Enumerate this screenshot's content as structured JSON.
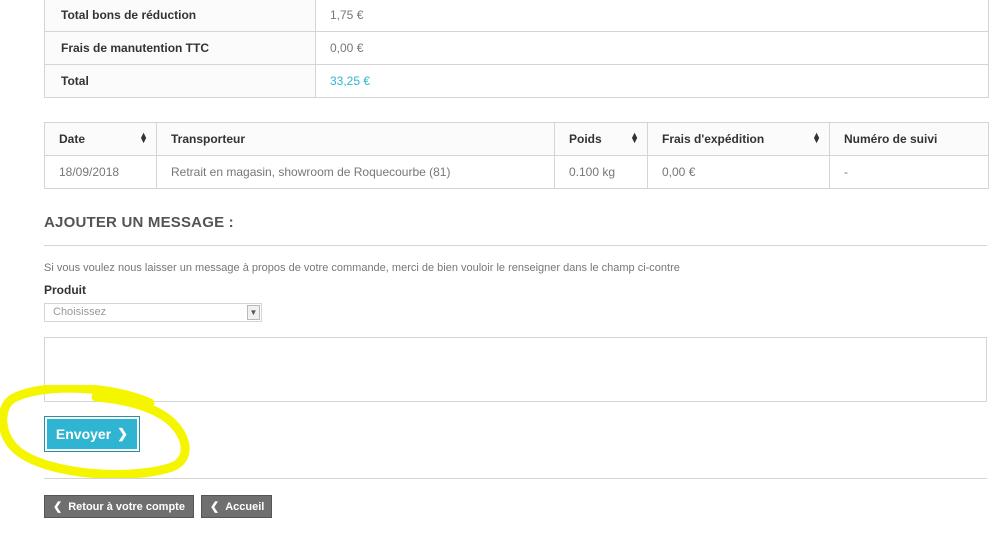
{
  "totals": [
    {
      "label": "Total bons de réduction",
      "value": "1,75 €"
    },
    {
      "label": "Frais de manutention TTC",
      "value": "0,00 €"
    },
    {
      "label": "Total",
      "value": "33,25 €"
    }
  ],
  "shipping": {
    "headers": [
      "Date",
      "Transporteur",
      "Poids",
      "Frais d'expédition",
      "Numéro de suivi"
    ],
    "row": [
      "18/09/2018",
      "Retrait en magasin, showroom de Roquecourbe (81)",
      "0.100 kg",
      "0,00 €",
      "-"
    ]
  },
  "message": {
    "heading": "AJOUTER UN MESSAGE :",
    "hint": "Si vous voulez nous laisser un message à propos de votre commande, merci de bien vouloir le renseigner dans le champ ci-contre",
    "product_label": "Produit",
    "product_selected": "Choisissez",
    "send_label": "Envoyer"
  },
  "nav": {
    "back_label": "Retour à votre compte",
    "home_label": "Accueil"
  },
  "colors": {
    "accent": "#2fb5d2",
    "highlight": "#f5f500"
  }
}
